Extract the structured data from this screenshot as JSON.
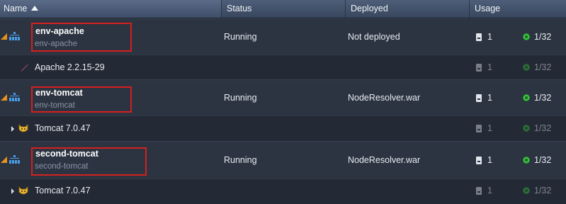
{
  "header": {
    "name_label": "Name",
    "status_label": "Status",
    "deployed_label": "Deployed",
    "usage_label": "Usage"
  },
  "rows": [
    {
      "type": "env",
      "name": "env-apache",
      "subtitle": "env-apache",
      "status": "Running",
      "deployed": "Not deployed",
      "disk": "1",
      "cloudlets": "1/32"
    },
    {
      "type": "node",
      "name": "Apache 2.2.15-29",
      "icon": "apache-feather-icon",
      "disk": "1",
      "cloudlets": "1/32"
    },
    {
      "type": "env",
      "name": "env-tomcat",
      "subtitle": "env-tomcat",
      "status": "Running",
      "deployed": "NodeResolver.war",
      "disk": "1",
      "cloudlets": "1/32"
    },
    {
      "type": "node",
      "name": "Tomcat 7.0.47",
      "icon": "tomcat-cat-icon",
      "disk": "1",
      "cloudlets": "1/32"
    },
    {
      "type": "env",
      "name": "second-tomcat",
      "subtitle": "second-tomcat",
      "status": "Running",
      "deployed": "NodeResolver.war",
      "disk": "1",
      "cloudlets": "1/32"
    },
    {
      "type": "node",
      "name": "Tomcat 7.0.47",
      "icon": "tomcat-cat-icon",
      "disk": "1",
      "cloudlets": "1/32"
    }
  ],
  "colors": {
    "highlight_box": "#d51f1f",
    "header_bg": "#4e5e79",
    "row_bg": "#2c3441",
    "cloudlet_green": "#3dcc45",
    "corner_orange": "#e8911c"
  }
}
